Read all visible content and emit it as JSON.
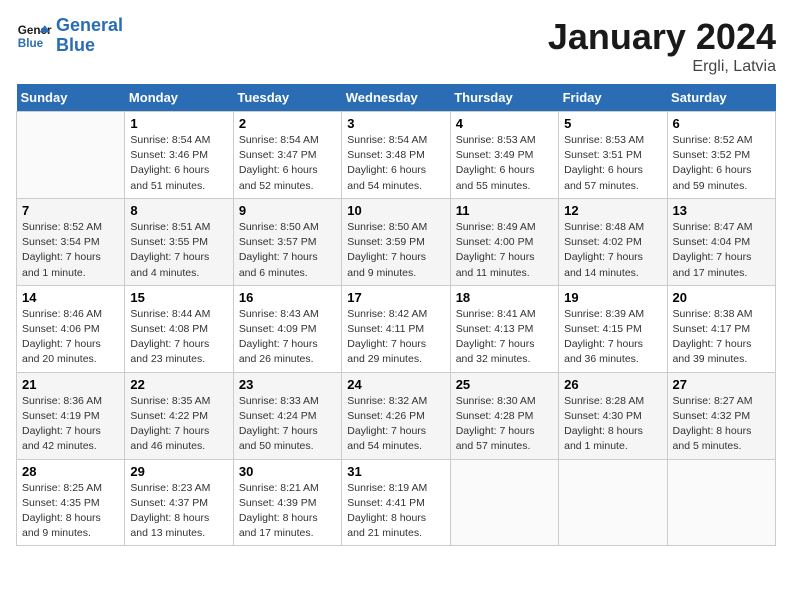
{
  "header": {
    "logo_line1": "General",
    "logo_line2": "Blue",
    "title": "January 2024",
    "subtitle": "Ergli, Latvia"
  },
  "columns": [
    "Sunday",
    "Monday",
    "Tuesday",
    "Wednesday",
    "Thursday",
    "Friday",
    "Saturday"
  ],
  "weeks": [
    [
      {
        "day": "",
        "info": ""
      },
      {
        "day": "1",
        "info": "Sunrise: 8:54 AM\nSunset: 3:46 PM\nDaylight: 6 hours\nand 51 minutes."
      },
      {
        "day": "2",
        "info": "Sunrise: 8:54 AM\nSunset: 3:47 PM\nDaylight: 6 hours\nand 52 minutes."
      },
      {
        "day": "3",
        "info": "Sunrise: 8:54 AM\nSunset: 3:48 PM\nDaylight: 6 hours\nand 54 minutes."
      },
      {
        "day": "4",
        "info": "Sunrise: 8:53 AM\nSunset: 3:49 PM\nDaylight: 6 hours\nand 55 minutes."
      },
      {
        "day": "5",
        "info": "Sunrise: 8:53 AM\nSunset: 3:51 PM\nDaylight: 6 hours\nand 57 minutes."
      },
      {
        "day": "6",
        "info": "Sunrise: 8:52 AM\nSunset: 3:52 PM\nDaylight: 6 hours\nand 59 minutes."
      }
    ],
    [
      {
        "day": "7",
        "info": "Sunrise: 8:52 AM\nSunset: 3:54 PM\nDaylight: 7 hours\nand 1 minute."
      },
      {
        "day": "8",
        "info": "Sunrise: 8:51 AM\nSunset: 3:55 PM\nDaylight: 7 hours\nand 4 minutes."
      },
      {
        "day": "9",
        "info": "Sunrise: 8:50 AM\nSunset: 3:57 PM\nDaylight: 7 hours\nand 6 minutes."
      },
      {
        "day": "10",
        "info": "Sunrise: 8:50 AM\nSunset: 3:59 PM\nDaylight: 7 hours\nand 9 minutes."
      },
      {
        "day": "11",
        "info": "Sunrise: 8:49 AM\nSunset: 4:00 PM\nDaylight: 7 hours\nand 11 minutes."
      },
      {
        "day": "12",
        "info": "Sunrise: 8:48 AM\nSunset: 4:02 PM\nDaylight: 7 hours\nand 14 minutes."
      },
      {
        "day": "13",
        "info": "Sunrise: 8:47 AM\nSunset: 4:04 PM\nDaylight: 7 hours\nand 17 minutes."
      }
    ],
    [
      {
        "day": "14",
        "info": "Sunrise: 8:46 AM\nSunset: 4:06 PM\nDaylight: 7 hours\nand 20 minutes."
      },
      {
        "day": "15",
        "info": "Sunrise: 8:44 AM\nSunset: 4:08 PM\nDaylight: 7 hours\nand 23 minutes."
      },
      {
        "day": "16",
        "info": "Sunrise: 8:43 AM\nSunset: 4:09 PM\nDaylight: 7 hours\nand 26 minutes."
      },
      {
        "day": "17",
        "info": "Sunrise: 8:42 AM\nSunset: 4:11 PM\nDaylight: 7 hours\nand 29 minutes."
      },
      {
        "day": "18",
        "info": "Sunrise: 8:41 AM\nSunset: 4:13 PM\nDaylight: 7 hours\nand 32 minutes."
      },
      {
        "day": "19",
        "info": "Sunrise: 8:39 AM\nSunset: 4:15 PM\nDaylight: 7 hours\nand 36 minutes."
      },
      {
        "day": "20",
        "info": "Sunrise: 8:38 AM\nSunset: 4:17 PM\nDaylight: 7 hours\nand 39 minutes."
      }
    ],
    [
      {
        "day": "21",
        "info": "Sunrise: 8:36 AM\nSunset: 4:19 PM\nDaylight: 7 hours\nand 42 minutes."
      },
      {
        "day": "22",
        "info": "Sunrise: 8:35 AM\nSunset: 4:22 PM\nDaylight: 7 hours\nand 46 minutes."
      },
      {
        "day": "23",
        "info": "Sunrise: 8:33 AM\nSunset: 4:24 PM\nDaylight: 7 hours\nand 50 minutes."
      },
      {
        "day": "24",
        "info": "Sunrise: 8:32 AM\nSunset: 4:26 PM\nDaylight: 7 hours\nand 54 minutes."
      },
      {
        "day": "25",
        "info": "Sunrise: 8:30 AM\nSunset: 4:28 PM\nDaylight: 7 hours\nand 57 minutes."
      },
      {
        "day": "26",
        "info": "Sunrise: 8:28 AM\nSunset: 4:30 PM\nDaylight: 8 hours\nand 1 minute."
      },
      {
        "day": "27",
        "info": "Sunrise: 8:27 AM\nSunset: 4:32 PM\nDaylight: 8 hours\nand 5 minutes."
      }
    ],
    [
      {
        "day": "28",
        "info": "Sunrise: 8:25 AM\nSunset: 4:35 PM\nDaylight: 8 hours\nand 9 minutes."
      },
      {
        "day": "29",
        "info": "Sunrise: 8:23 AM\nSunset: 4:37 PM\nDaylight: 8 hours\nand 13 minutes."
      },
      {
        "day": "30",
        "info": "Sunrise: 8:21 AM\nSunset: 4:39 PM\nDaylight: 8 hours\nand 17 minutes."
      },
      {
        "day": "31",
        "info": "Sunrise: 8:19 AM\nSunset: 4:41 PM\nDaylight: 8 hours\nand 21 minutes."
      },
      {
        "day": "",
        "info": ""
      },
      {
        "day": "",
        "info": ""
      },
      {
        "day": "",
        "info": ""
      }
    ]
  ]
}
